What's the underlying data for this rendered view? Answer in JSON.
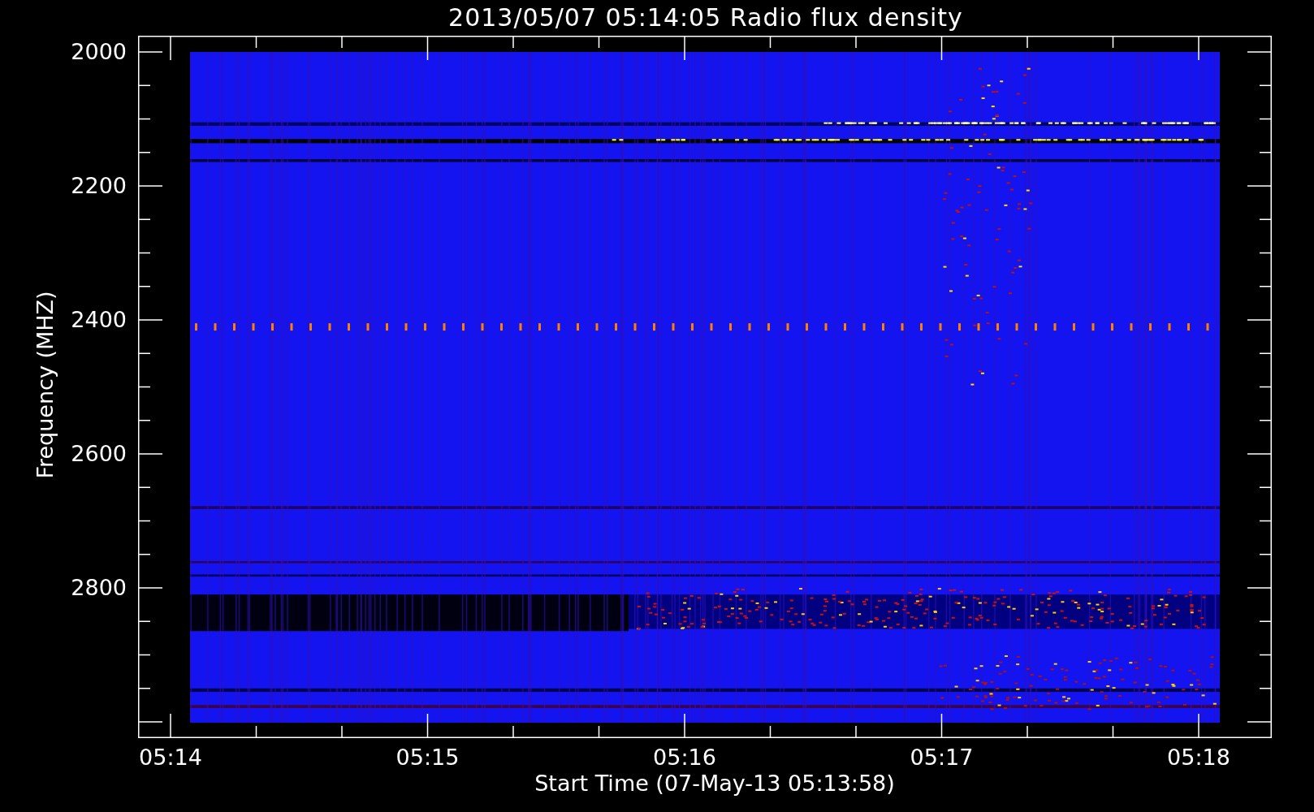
{
  "title": "2013/05/07 05:14:05 Radio flux density",
  "plot": {
    "ylabel": "Frequency (MHZ)",
    "xlabel": "Start Time (07-May-13 05:13:58)",
    "yticks": [
      "2000",
      "2200",
      "2400",
      "2600",
      "2800"
    ],
    "xticks": [
      "05:14",
      "05:15",
      "05:16",
      "05:17",
      "05:18"
    ]
  }
}
